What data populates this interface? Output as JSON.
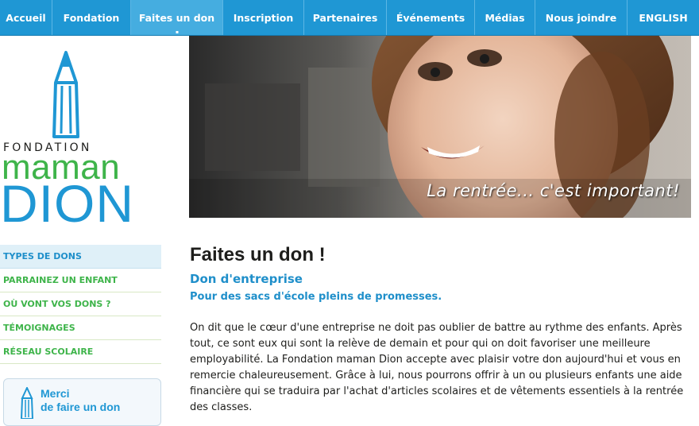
{
  "nav": {
    "items": [
      {
        "label": "Accueil"
      },
      {
        "label": "Fondation"
      },
      {
        "label": "Faites un don"
      },
      {
        "label": "Inscription"
      },
      {
        "label": "Partenaires"
      },
      {
        "label": "Événements"
      },
      {
        "label": "Médias"
      },
      {
        "label": "Nous joindre"
      },
      {
        "label": "ENGLISH"
      }
    ],
    "active": "Faites un don"
  },
  "logo": {
    "line1": "FONDATION",
    "line2": "maman",
    "line3": "DION"
  },
  "hero": {
    "tagline": "La rentrée... c'est important!"
  },
  "sidebar": {
    "items": [
      {
        "label": "TYPES DE DONS"
      },
      {
        "label": "PARRAINEZ UN ENFANT"
      },
      {
        "label": "OÙ VONT VOS DONS ?"
      },
      {
        "label": "TÉMOIGNAGES"
      },
      {
        "label": "RÉSEAU SCOLAIRE"
      }
    ],
    "thanks_line1": "Merci",
    "thanks_line2": "de faire un don"
  },
  "main": {
    "title": "Faites un don !",
    "subtitle": "Don d'entreprise",
    "subheading": "Pour des sacs d'école pleins de promesses.",
    "paragraph": "On dit que le cœur d'une entreprise ne doit pas oublier de battre au rythme des enfants. Après tout, ce sont eux qui sont la relève de demain et pour qui on doit favoriser une meilleure employabilité. La Fondation maman Dion accepte avec plaisir votre don aujourd'hui et vous en remercie chaleureusement. Grâce à lui, nous pourrons offrir à un ou plusieurs enfants une aide financière qui se traduira par l'achat d'articles scolaires et de vêtements essentiels à la rentrée des classes."
  },
  "colors": {
    "nav_bg": "#1f97d4",
    "brand_green": "#3eb44a",
    "brand_blue": "#1f97d4"
  }
}
